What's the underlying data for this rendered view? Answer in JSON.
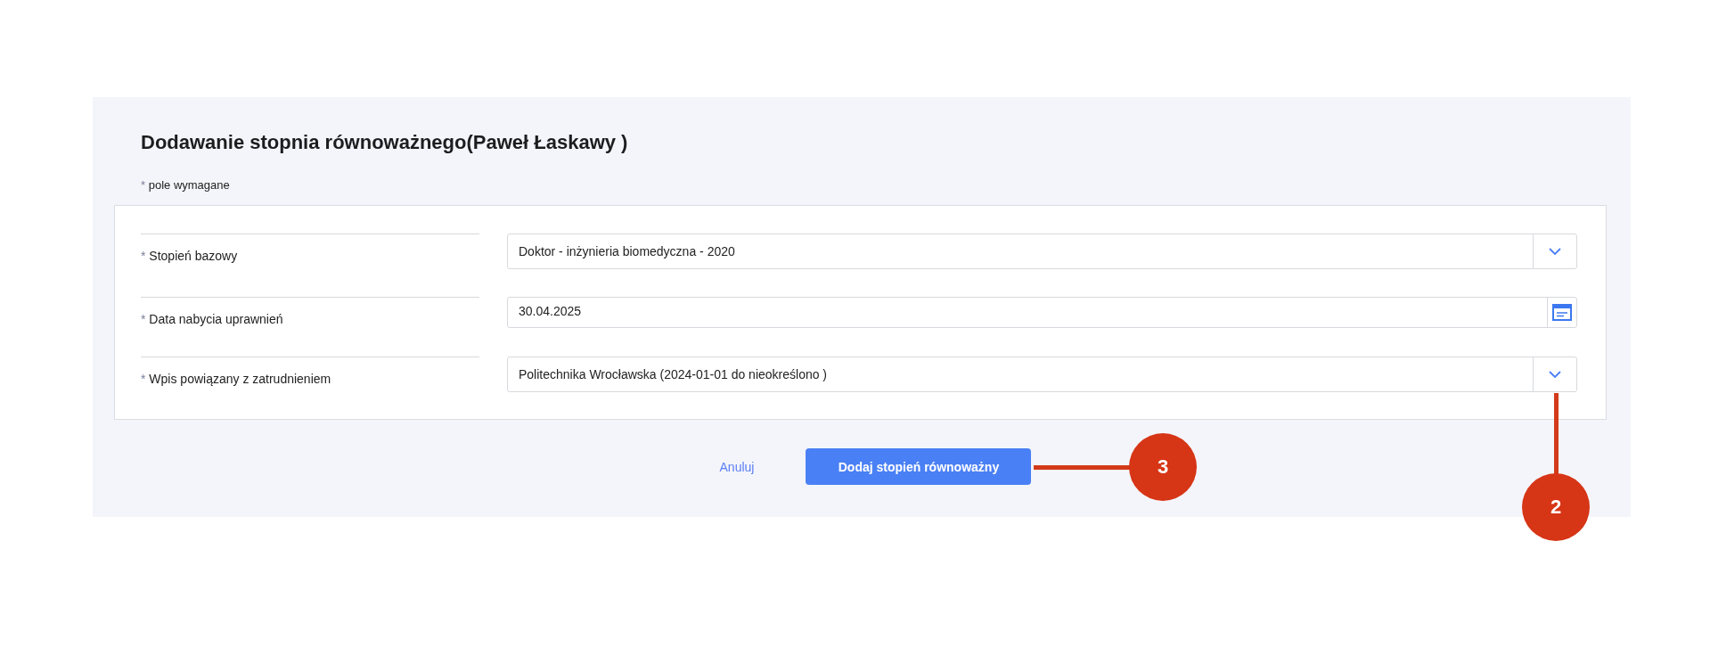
{
  "title": "Dodawanie stopnia równoważnego(Paweł Łaskawy )",
  "required_note": {
    "marker": "*",
    "text": "pole wymagane"
  },
  "fields": [
    {
      "marker": "*",
      "label": "Stopień bazowy",
      "kind": "select",
      "value": "Doktor - inżynieria biomedyczna - 2020"
    },
    {
      "marker": "*",
      "label": "Data nabycia uprawnień",
      "kind": "date",
      "value": "30.04.2025"
    },
    {
      "marker": "*",
      "label": "Wpis powiązany z zatrudnieniem",
      "kind": "select",
      "value": "Politechnika Wrocławska (2024-01-01 do nieokreślono )"
    }
  ],
  "buttons": {
    "cancel": "Anuluj",
    "submit": "Dodaj stopień równoważny"
  },
  "callouts": [
    {
      "number": "3",
      "kind": "horizontal"
    },
    {
      "number": "2",
      "kind": "vertical"
    }
  ]
}
